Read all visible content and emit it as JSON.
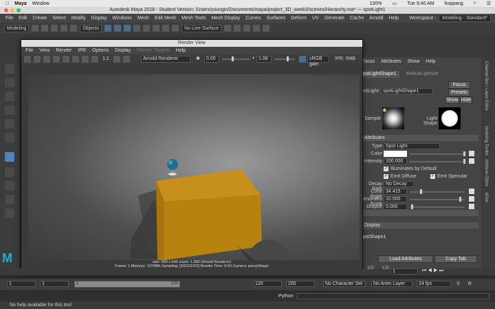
{
  "mac_menu": {
    "app": "Maya",
    "window": "Window",
    "battery": "100%",
    "clock": "Tue 9:40 AM",
    "user": "hoppang"
  },
  "window_title": "Autodesk Maya 2018 - Student Version: /Users/youngin/Documents/maya/project_3D_week3/scenes/Hierarchy.ma*  ---  spotLight1",
  "maya_menus": [
    "File",
    "Edit",
    "Create",
    "Select",
    "Modify",
    "Display",
    "Windows",
    "Mesh",
    "Edit Mesh",
    "Mesh Tools",
    "Mesh Display",
    "Curves",
    "Surfaces",
    "Deform",
    "UV",
    "Generate",
    "Cache",
    "Arnold",
    "Help"
  ],
  "workspace": {
    "label": "Workspace :",
    "value": "Modeling - Standard*"
  },
  "status_line": {
    "mode": "Modeling",
    "objects": "Objects",
    "live_surface": "No Live Surface"
  },
  "render_view": {
    "title": "Render View",
    "menus": [
      "File",
      "View",
      "Render",
      "IPR",
      "Options",
      "Display",
      "Render Targets",
      "Help"
    ],
    "ratio": "1:1",
    "renderer": "Arnold Renderer",
    "exposure": "0.00",
    "gamma": "1.08",
    "colorspace": "sRGB gam",
    "ipr": "IPR: 0MB",
    "status_line1": "size: 960 x 540  zoom: 1.000   (Arnold Renderer)",
    "status_line2": "Frame: 1     Memory: 1374Mb     Sampling: [3/2/2/2/2/2]     Render Time: 0:43     Camera: perspShape"
  },
  "attribute_editor": {
    "menus": [
      "Focus",
      "Attributes",
      "Show",
      "Help"
    ],
    "tabs": [
      "spotLightShape1",
      "defaultLightSet"
    ],
    "node_label": "spotLight:",
    "node_value": "spotLightShape1",
    "buttons": {
      "focus": "Focus",
      "presets": "Presets",
      "show": "Show",
      "hide": "Hide"
    },
    "sample_label": "Sample",
    "light_shape_label": "Light Shape",
    "section_attributes": "Attributes",
    "type_label": "Type",
    "type_value": "Spot Light",
    "color_label": "Color",
    "intensity_label": "Intensity",
    "intensity_value": "100.000",
    "illuminates_default": "Illuminates by Default",
    "emit_diffuse": "Emit Diffuse",
    "emit_specular": "Emit Specular",
    "decay_label": "Decay Rate",
    "decay_value": "No Decay",
    "cone_label": "Cone Angle",
    "cone_value": "34.415",
    "penumbra_label": "Penumbra Angle",
    "penumbra_value": "10.000",
    "dropoff_label": "Dropoff",
    "dropoff_value": "0.000",
    "section_hidden1": "",
    "section_display": "Display",
    "node_footer": "spotShape1",
    "load_attributes": "Load Attributes",
    "copy_tab": "Copy Tab"
  },
  "side_tabs": [
    "Channel Box / Layer Editor",
    "Modeling Toolkit",
    "Attribute Editor",
    "XGen"
  ],
  "time_slider": {
    "end_tick": "115",
    "right_tick": "120",
    "current_frame": "1"
  },
  "range_slider": {
    "start": "1",
    "inner_start": "1",
    "range_left": "1",
    "range_right": "120",
    "end": "120",
    "max": "200",
    "character_set": "No Character Set",
    "anim_layer": "No Anim Layer",
    "fps": "24 fps"
  },
  "command_line": {
    "language": "Python"
  },
  "help_line": "No help available for this tool"
}
